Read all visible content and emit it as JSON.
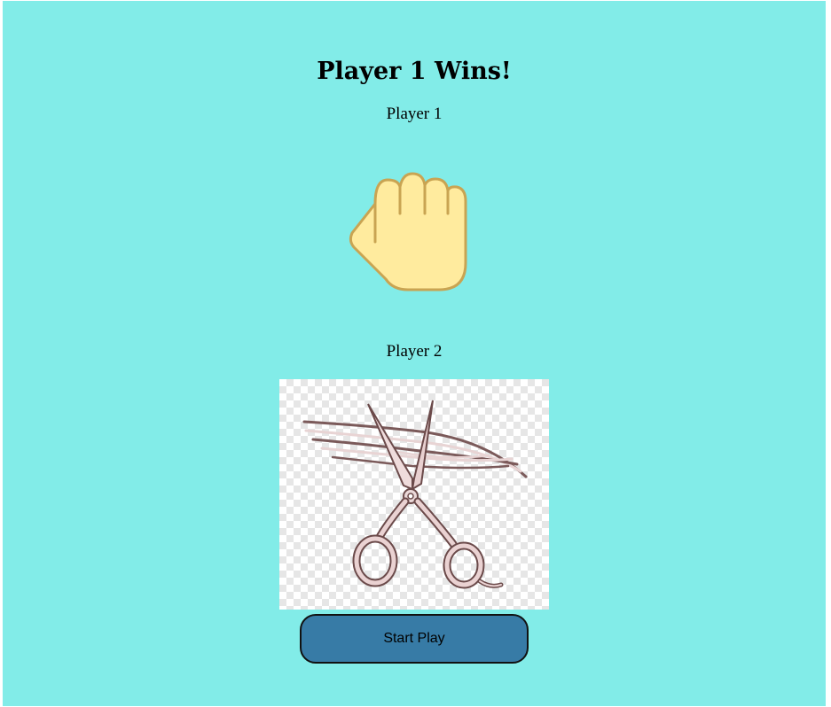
{
  "result": {
    "title": "Player 1 Wins!"
  },
  "player1": {
    "label": "Player 1",
    "choice_icon": "rock-fist-icon"
  },
  "player2": {
    "label": "Player 2",
    "choice_icon": "scissors-icon"
  },
  "controls": {
    "start_label": "Start Play"
  },
  "colors": {
    "background": "#82ece8",
    "button": "#377ba6",
    "fist_fill": "#ffeb9e",
    "fist_outline": "#c9a452"
  }
}
